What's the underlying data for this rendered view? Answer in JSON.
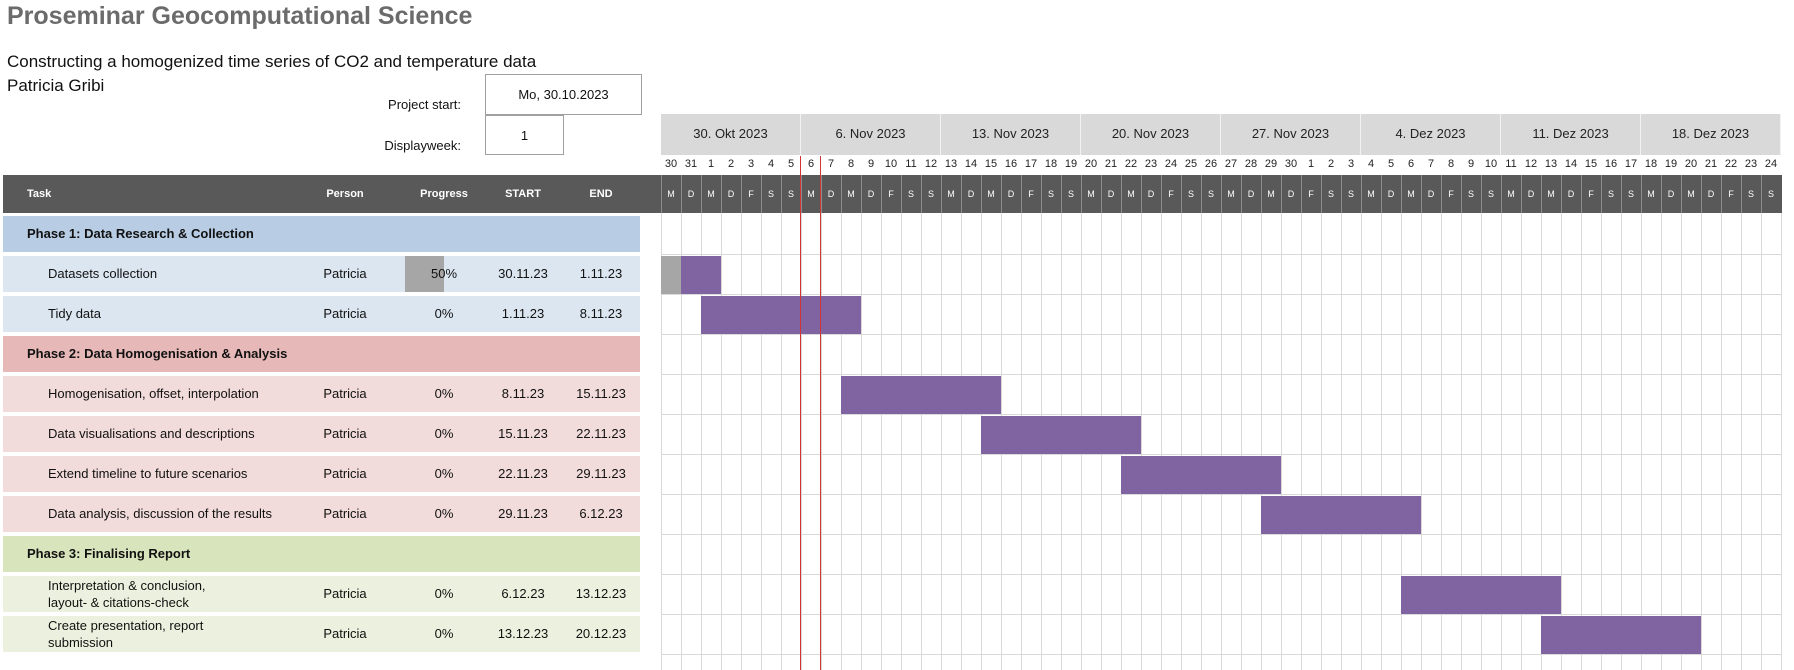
{
  "title": "Proseminar Geocomputational Science",
  "subtitle": "Constructing a homogenized time series of CO2 and temperature data",
  "author": "Patricia Gribi",
  "project_start_label": "Project start:",
  "project_start_value": "Mo, 30.10.2023",
  "display_week_label": "Displayweek:",
  "display_week_value": "1",
  "columns": {
    "task": "Task",
    "person": "Person",
    "progress": "Progress",
    "start": "START",
    "end": "END"
  },
  "weeks": [
    "30. Okt 2023",
    "6. Nov 2023",
    "13. Nov 2023",
    "20. Nov 2023",
    "27. Nov 2023",
    "4. Dez 2023",
    "11. Dez 2023",
    "18. Dez 2023"
  ],
  "day_numbers": [
    "30",
    "31",
    "1",
    "2",
    "3",
    "4",
    "5",
    "6",
    "7",
    "8",
    "9",
    "10",
    "11",
    "12",
    "13",
    "14",
    "15",
    "16",
    "17",
    "18",
    "19",
    "20",
    "21",
    "22",
    "23",
    "24",
    "25",
    "26",
    "27",
    "28",
    "29",
    "30",
    "1",
    "2",
    "3",
    "4",
    "5",
    "6",
    "7",
    "8",
    "9",
    "10",
    "11",
    "12",
    "13",
    "14",
    "15",
    "16",
    "17",
    "18",
    "19",
    "20",
    "21",
    "22",
    "23",
    "24"
  ],
  "day_letters": [
    "M",
    "D",
    "M",
    "D",
    "F",
    "S",
    "S"
  ],
  "colors": {
    "phase1_header": "#b8cce4",
    "phase1_row": "#dce6f1",
    "phase2_header": "#e6b8b7",
    "phase2_row": "#f2dcdb",
    "phase3_header": "#d8e4bc",
    "phase3_row": "#ebf1de",
    "bar": "#8064a2",
    "progress": "#a6a6a6",
    "today_line": "#d33333"
  },
  "rows": [
    {
      "type": "phase",
      "phase": 1,
      "task": "Phase 1: Data Research & Collection"
    },
    {
      "type": "task",
      "phase": 1,
      "task": "Datasets collection",
      "person": "Patricia",
      "progress": "50%",
      "progress_fraction": 0.5,
      "start": "30.11.23",
      "end": "1.11.23",
      "day_start": 0,
      "day_count": 3
    },
    {
      "type": "task",
      "phase": 1,
      "task": "Tidy data",
      "person": "Patricia",
      "progress": "0%",
      "progress_fraction": 0,
      "start": "1.11.23",
      "end": "8.11.23",
      "day_start": 2,
      "day_count": 8
    },
    {
      "type": "phase",
      "phase": 2,
      "task": "Phase 2: Data Homogenisation & Analysis"
    },
    {
      "type": "task",
      "phase": 2,
      "task": "Homogenisation, offset, interpolation",
      "person": "Patricia",
      "progress": "0%",
      "progress_fraction": 0,
      "start": "8.11.23",
      "end": "15.11.23",
      "day_start": 9,
      "day_count": 8
    },
    {
      "type": "task",
      "phase": 2,
      "task": "Data visualisations and descriptions",
      "person": "Patricia",
      "progress": "0%",
      "progress_fraction": 0,
      "start": "15.11.23",
      "end": "22.11.23",
      "day_start": 16,
      "day_count": 8
    },
    {
      "type": "task",
      "phase": 2,
      "task": "Extend timeline to future scenarios",
      "person": "Patricia",
      "progress": "0%",
      "progress_fraction": 0,
      "start": "22.11.23",
      "end": "29.11.23",
      "day_start": 23,
      "day_count": 8
    },
    {
      "type": "task",
      "phase": 2,
      "task": "Data analysis, discussion of the results",
      "person": "Patricia",
      "progress": "0%",
      "progress_fraction": 0,
      "start": "29.11.23",
      "end": "6.12.23",
      "day_start": 30,
      "day_count": 8
    },
    {
      "type": "phase",
      "phase": 3,
      "task": "Phase 3: Finalising Report"
    },
    {
      "type": "task",
      "phase": 3,
      "task": "Interpretation & conclusion,\nlayout- & citations-check",
      "person": "Patricia",
      "progress": "0%",
      "progress_fraction": 0,
      "start": "6.12.23",
      "end": "13.12.23",
      "day_start": 37,
      "day_count": 8
    },
    {
      "type": "task",
      "phase": 3,
      "task": "Create presentation, report\nsubmission",
      "person": "Patricia",
      "progress": "0%",
      "progress_fraction": 0,
      "start": "13.12.23",
      "end": "20.12.23",
      "day_start": 44,
      "day_count": 8
    }
  ],
  "today_marker": {
    "day_index": 8
  }
}
